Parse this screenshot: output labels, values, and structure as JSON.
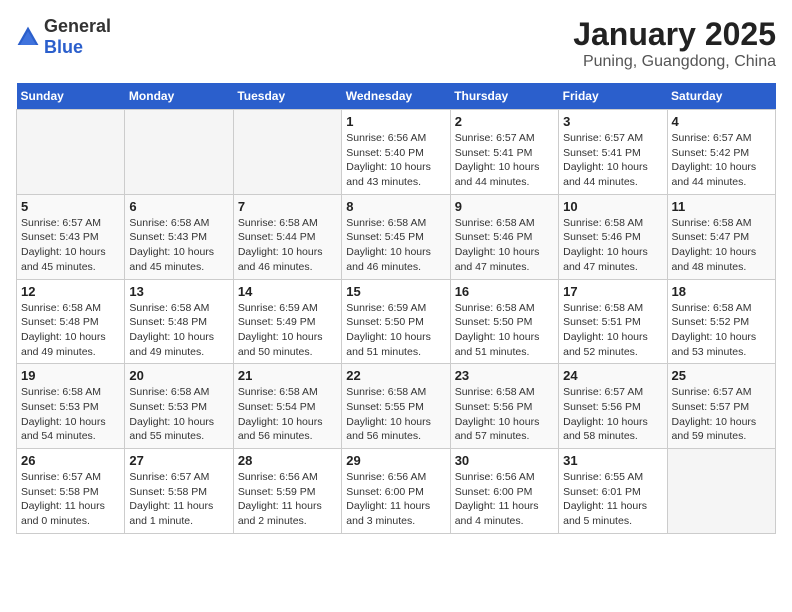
{
  "logo": {
    "general": "General",
    "blue": "Blue"
  },
  "title": "January 2025",
  "subtitle": "Puning, Guangdong, China",
  "weekdays": [
    "Sunday",
    "Monday",
    "Tuesday",
    "Wednesday",
    "Thursday",
    "Friday",
    "Saturday"
  ],
  "weeks": [
    [
      {
        "day": "",
        "info": ""
      },
      {
        "day": "",
        "info": ""
      },
      {
        "day": "",
        "info": ""
      },
      {
        "day": "1",
        "info": "Sunrise: 6:56 AM\nSunset: 5:40 PM\nDaylight: 10 hours\nand 43 minutes."
      },
      {
        "day": "2",
        "info": "Sunrise: 6:57 AM\nSunset: 5:41 PM\nDaylight: 10 hours\nand 44 minutes."
      },
      {
        "day": "3",
        "info": "Sunrise: 6:57 AM\nSunset: 5:41 PM\nDaylight: 10 hours\nand 44 minutes."
      },
      {
        "day": "4",
        "info": "Sunrise: 6:57 AM\nSunset: 5:42 PM\nDaylight: 10 hours\nand 44 minutes."
      }
    ],
    [
      {
        "day": "5",
        "info": "Sunrise: 6:57 AM\nSunset: 5:43 PM\nDaylight: 10 hours\nand 45 minutes."
      },
      {
        "day": "6",
        "info": "Sunrise: 6:58 AM\nSunset: 5:43 PM\nDaylight: 10 hours\nand 45 minutes."
      },
      {
        "day": "7",
        "info": "Sunrise: 6:58 AM\nSunset: 5:44 PM\nDaylight: 10 hours\nand 46 minutes."
      },
      {
        "day": "8",
        "info": "Sunrise: 6:58 AM\nSunset: 5:45 PM\nDaylight: 10 hours\nand 46 minutes."
      },
      {
        "day": "9",
        "info": "Sunrise: 6:58 AM\nSunset: 5:46 PM\nDaylight: 10 hours\nand 47 minutes."
      },
      {
        "day": "10",
        "info": "Sunrise: 6:58 AM\nSunset: 5:46 PM\nDaylight: 10 hours\nand 47 minutes."
      },
      {
        "day": "11",
        "info": "Sunrise: 6:58 AM\nSunset: 5:47 PM\nDaylight: 10 hours\nand 48 minutes."
      }
    ],
    [
      {
        "day": "12",
        "info": "Sunrise: 6:58 AM\nSunset: 5:48 PM\nDaylight: 10 hours\nand 49 minutes."
      },
      {
        "day": "13",
        "info": "Sunrise: 6:58 AM\nSunset: 5:48 PM\nDaylight: 10 hours\nand 49 minutes."
      },
      {
        "day": "14",
        "info": "Sunrise: 6:59 AM\nSunset: 5:49 PM\nDaylight: 10 hours\nand 50 minutes."
      },
      {
        "day": "15",
        "info": "Sunrise: 6:59 AM\nSunset: 5:50 PM\nDaylight: 10 hours\nand 51 minutes."
      },
      {
        "day": "16",
        "info": "Sunrise: 6:58 AM\nSunset: 5:50 PM\nDaylight: 10 hours\nand 51 minutes."
      },
      {
        "day": "17",
        "info": "Sunrise: 6:58 AM\nSunset: 5:51 PM\nDaylight: 10 hours\nand 52 minutes."
      },
      {
        "day": "18",
        "info": "Sunrise: 6:58 AM\nSunset: 5:52 PM\nDaylight: 10 hours\nand 53 minutes."
      }
    ],
    [
      {
        "day": "19",
        "info": "Sunrise: 6:58 AM\nSunset: 5:53 PM\nDaylight: 10 hours\nand 54 minutes."
      },
      {
        "day": "20",
        "info": "Sunrise: 6:58 AM\nSunset: 5:53 PM\nDaylight: 10 hours\nand 55 minutes."
      },
      {
        "day": "21",
        "info": "Sunrise: 6:58 AM\nSunset: 5:54 PM\nDaylight: 10 hours\nand 56 minutes."
      },
      {
        "day": "22",
        "info": "Sunrise: 6:58 AM\nSunset: 5:55 PM\nDaylight: 10 hours\nand 56 minutes."
      },
      {
        "day": "23",
        "info": "Sunrise: 6:58 AM\nSunset: 5:56 PM\nDaylight: 10 hours\nand 57 minutes."
      },
      {
        "day": "24",
        "info": "Sunrise: 6:57 AM\nSunset: 5:56 PM\nDaylight: 10 hours\nand 58 minutes."
      },
      {
        "day": "25",
        "info": "Sunrise: 6:57 AM\nSunset: 5:57 PM\nDaylight: 10 hours\nand 59 minutes."
      }
    ],
    [
      {
        "day": "26",
        "info": "Sunrise: 6:57 AM\nSunset: 5:58 PM\nDaylight: 11 hours\nand 0 minutes."
      },
      {
        "day": "27",
        "info": "Sunrise: 6:57 AM\nSunset: 5:58 PM\nDaylight: 11 hours\nand 1 minute."
      },
      {
        "day": "28",
        "info": "Sunrise: 6:56 AM\nSunset: 5:59 PM\nDaylight: 11 hours\nand 2 minutes."
      },
      {
        "day": "29",
        "info": "Sunrise: 6:56 AM\nSunset: 6:00 PM\nDaylight: 11 hours\nand 3 minutes."
      },
      {
        "day": "30",
        "info": "Sunrise: 6:56 AM\nSunset: 6:00 PM\nDaylight: 11 hours\nand 4 minutes."
      },
      {
        "day": "31",
        "info": "Sunrise: 6:55 AM\nSunset: 6:01 PM\nDaylight: 11 hours\nand 5 minutes."
      },
      {
        "day": "",
        "info": ""
      }
    ]
  ]
}
